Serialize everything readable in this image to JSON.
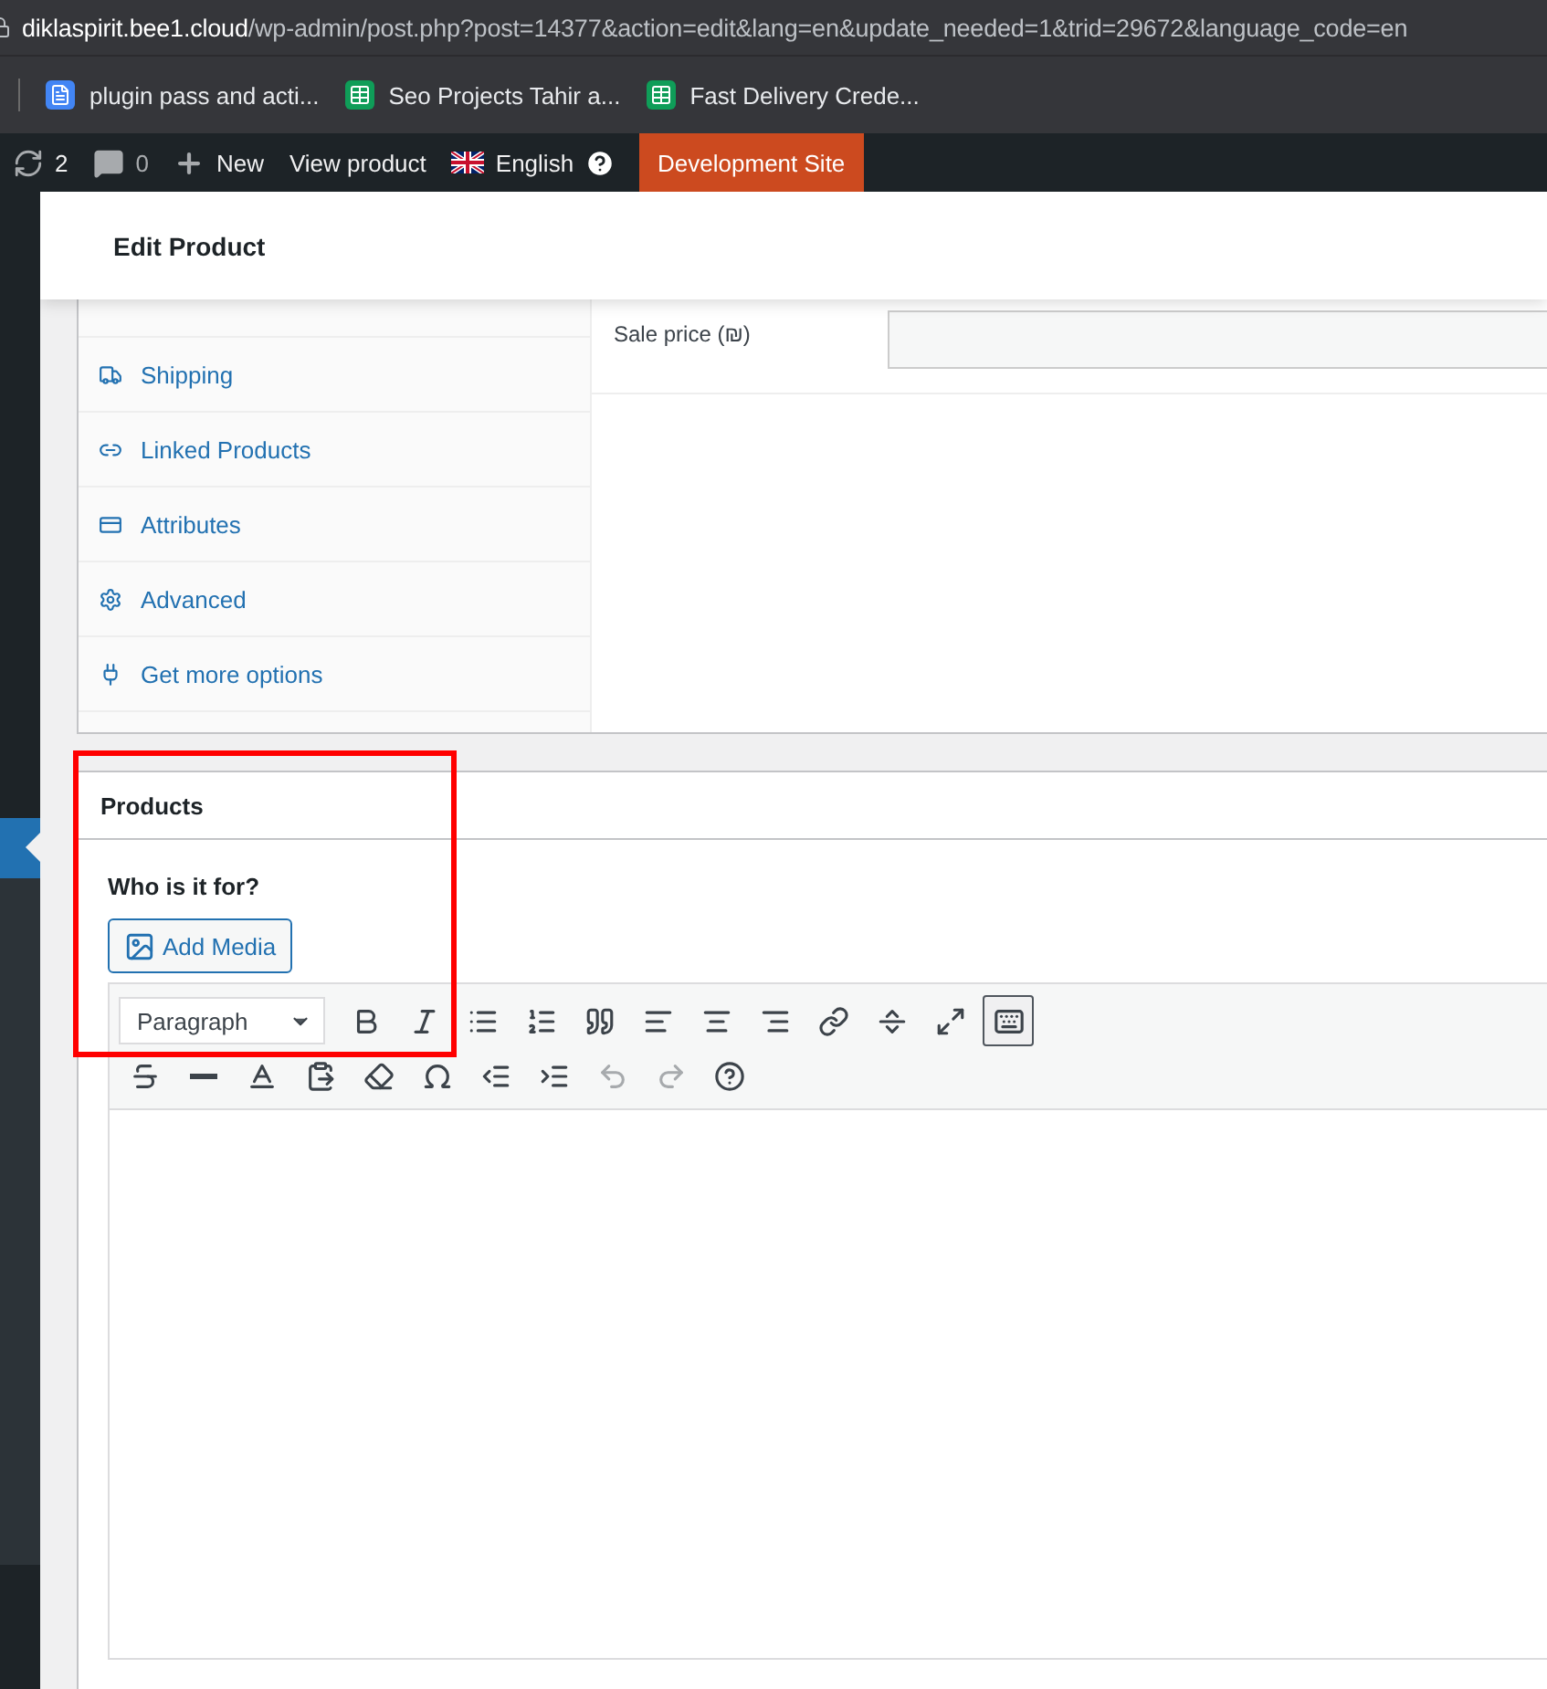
{
  "browser": {
    "url_host": "diklaspirit.bee1.cloud",
    "url_path": "/wp-admin/post.php?post=14377&action=edit&lang=en&update_needed=1&trid=29672&language_code=en",
    "bookmarks": [
      {
        "label": "plugin pass and acti...",
        "kind": "doc"
      },
      {
        "label": "Seo Projects Tahir a...",
        "kind": "sheet"
      },
      {
        "label": "Fast Delivery Crede...",
        "kind": "sheet"
      }
    ]
  },
  "admin_bar": {
    "updates": "2",
    "comments": "0",
    "new": "New",
    "view": "View product",
    "language": "English",
    "site_label": "Development Site"
  },
  "header": {
    "title": "Edit Product"
  },
  "product_data": {
    "tabs": [
      {
        "label": "Shipping",
        "kind": "shipping"
      },
      {
        "label": "Linked Products",
        "kind": "linked"
      },
      {
        "label": "Attributes",
        "kind": "attributes"
      },
      {
        "label": "Advanced",
        "kind": "advanced"
      },
      {
        "label": "Get more options",
        "kind": "more"
      }
    ],
    "sale_price_label": "Sale price (₪)"
  },
  "products_box": {
    "title": "Products",
    "question": "Who is it for?",
    "add_media": "Add Media",
    "editor": {
      "format": "Paragraph",
      "toolbar_toggle_selected": true,
      "undo_disabled": true,
      "redo_disabled": true
    }
  }
}
